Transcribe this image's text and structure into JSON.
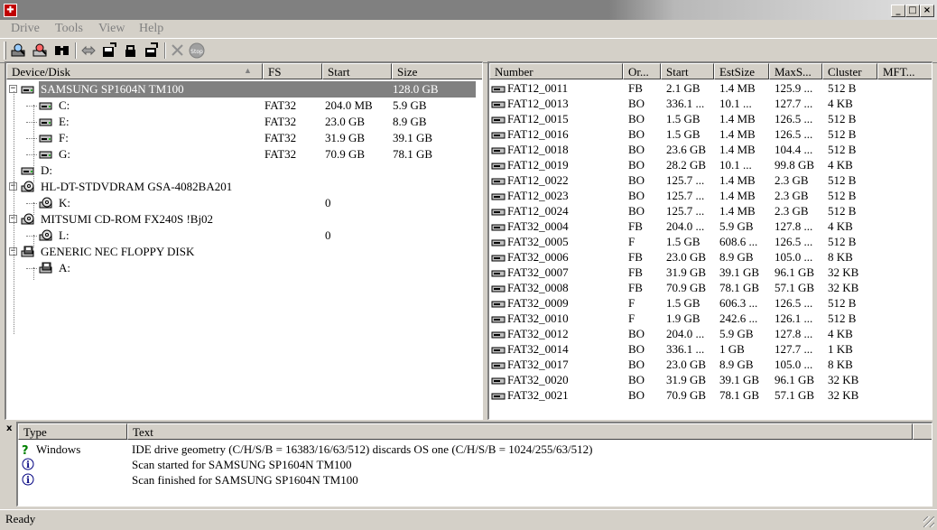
{
  "menu": [
    {
      "label": "Drive"
    },
    {
      "label": "Tools"
    },
    {
      "label": "View"
    },
    {
      "label": "Help"
    }
  ],
  "window_controls": {
    "minimize": "_",
    "maximize": "□",
    "close": "×"
  },
  "toolbar": {
    "buttons": [
      {
        "icon": "scan-drive-icon"
      },
      {
        "icon": "scan-partition-icon"
      },
      {
        "icon": "find-icon"
      },
      {
        "icon": "swap-icon"
      },
      {
        "icon": "save-icon"
      },
      {
        "icon": "lock-icon"
      },
      {
        "icon": "export-icon"
      },
      {
        "icon": "cancel-icon"
      },
      {
        "icon": "stop-icon",
        "label": "Stop"
      }
    ]
  },
  "device_tree": {
    "columns": [
      "Device/Disk",
      "FS",
      "Start",
      "Size"
    ],
    "rows": [
      {
        "name": "SAMSUNG SP1604N TM100",
        "fs": "",
        "start": "",
        "size": "128.0 GB",
        "level": 0,
        "expander": "-",
        "icon": "hard-disk-icon",
        "selected": true
      },
      {
        "name": "C:",
        "fs": "FAT32",
        "start": "204.0 MB",
        "size": "5.9 GB",
        "level": 1,
        "icon": "partition-icon"
      },
      {
        "name": "E:",
        "fs": "FAT32",
        "start": "23.0 GB",
        "size": "8.9 GB",
        "level": 1,
        "icon": "partition-icon"
      },
      {
        "name": "F:",
        "fs": "FAT32",
        "start": "31.9 GB",
        "size": "39.1 GB",
        "level": 1,
        "icon": "partition-icon"
      },
      {
        "name": "G:",
        "fs": "FAT32",
        "start": "70.9 GB",
        "size": "78.1 GB",
        "level": 1,
        "icon": "partition-icon"
      },
      {
        "name": "D:",
        "fs": "",
        "start": "",
        "size": "",
        "level": 0,
        "icon": "partition-icon"
      },
      {
        "name": "HL-DT-STDVDRAM GSA-4082BA201",
        "fs": "",
        "start": "",
        "size": "",
        "level": 0,
        "expander": "-",
        "icon": "cd-drive-icon"
      },
      {
        "name": "K:",
        "fs": "",
        "start": "0",
        "size": "",
        "level": 1,
        "icon": "cd-icon"
      },
      {
        "name": "MITSUMI CD-ROM FX240S !Bj02",
        "fs": "",
        "start": "",
        "size": "",
        "level": 0,
        "expander": "-",
        "icon": "cd-drive-icon"
      },
      {
        "name": "L:",
        "fs": "",
        "start": "0",
        "size": "",
        "level": 1,
        "icon": "cd-icon"
      },
      {
        "name": "GENERIC NEC FLOPPY DISK",
        "fs": "",
        "start": "",
        "size": "",
        "level": 0,
        "expander": "-",
        "icon": "floppy-drive-icon"
      },
      {
        "name": "A:",
        "fs": "",
        "start": "",
        "size": "",
        "level": 1,
        "icon": "floppy-icon"
      }
    ]
  },
  "partition_list": {
    "columns": [
      "Number",
      "Or...",
      "Start",
      "EstSize",
      "MaxS...",
      "Cluster",
      "MFT..."
    ],
    "rows": [
      [
        "FAT12_0011",
        "FB",
        "2.1 GB",
        "1.4 MB",
        "125.9 ...",
        "512 B",
        ""
      ],
      [
        "FAT12_0013",
        "BO",
        "336.1 ...",
        "10.1 ...",
        "127.7 ...",
        "4 KB",
        ""
      ],
      [
        "FAT12_0015",
        "BO",
        "1.5 GB",
        "1.4 MB",
        "126.5 ...",
        "512 B",
        ""
      ],
      [
        "FAT12_0016",
        "BO",
        "1.5 GB",
        "1.4 MB",
        "126.5 ...",
        "512 B",
        ""
      ],
      [
        "FAT12_0018",
        "BO",
        "23.6 GB",
        "1.4 MB",
        "104.4 ...",
        "512 B",
        ""
      ],
      [
        "FAT12_0019",
        "BO",
        "28.2 GB",
        "10.1 ...",
        "99.8 GB",
        "4 KB",
        ""
      ],
      [
        "FAT12_0022",
        "BO",
        "125.7 ...",
        "1.4 MB",
        "2.3 GB",
        "512 B",
        ""
      ],
      [
        "FAT12_0023",
        "BO",
        "125.7 ...",
        "1.4 MB",
        "2.3 GB",
        "512 B",
        ""
      ],
      [
        "FAT12_0024",
        "BO",
        "125.7 ...",
        "1.4 MB",
        "2.3 GB",
        "512 B",
        ""
      ],
      [
        "FAT32_0004",
        "FB",
        "204.0 ...",
        "5.9 GB",
        "127.8 ...",
        "4 KB",
        ""
      ],
      [
        "FAT32_0005",
        "F",
        "1.5 GB",
        "608.6 ...",
        "126.5 ...",
        "512 B",
        ""
      ],
      [
        "FAT32_0006",
        "FB",
        "23.0 GB",
        "8.9 GB",
        "105.0 ...",
        "8 KB",
        ""
      ],
      [
        "FAT32_0007",
        "FB",
        "31.9 GB",
        "39.1 GB",
        "96.1 GB",
        "32 KB",
        ""
      ],
      [
        "FAT32_0008",
        "FB",
        "70.9 GB",
        "78.1 GB",
        "57.1 GB",
        "32 KB",
        ""
      ],
      [
        "FAT32_0009",
        "F",
        "1.5 GB",
        "606.3 ...",
        "126.5 ...",
        "512 B",
        ""
      ],
      [
        "FAT32_0010",
        "F",
        "1.9 GB",
        "242.6 ...",
        "126.1 ...",
        "512 B",
        ""
      ],
      [
        "FAT32_0012",
        "BO",
        "204.0 ...",
        "5.9 GB",
        "127.8 ...",
        "4 KB",
        ""
      ],
      [
        "FAT32_0014",
        "BO",
        "336.1 ...",
        "1 GB",
        "127.7 ...",
        "1 KB",
        ""
      ],
      [
        "FAT32_0017",
        "BO",
        "23.0 GB",
        "8.9 GB",
        "105.0 ...",
        "8 KB",
        ""
      ],
      [
        "FAT32_0020",
        "BO",
        "31.9 GB",
        "39.1 GB",
        "96.1 GB",
        "32 KB",
        ""
      ],
      [
        "FAT32_0021",
        "BO",
        "70.9 GB",
        "78.1 GB",
        "57.1 GB",
        "32 KB",
        ""
      ]
    ]
  },
  "log": {
    "close_label": "x",
    "columns": [
      "Type",
      "Text"
    ],
    "rows": [
      {
        "type": "Windows",
        "icon": "question-icon",
        "text": "IDE drive geometry (C/H/S/B = 16383/16/63/512) discards OS one (C/H/S/B = 1024/255/63/512)"
      },
      {
        "type": "",
        "icon": "info-icon",
        "text": "Scan started for SAMSUNG SP1604N TM100"
      },
      {
        "type": "",
        "icon": "info-icon",
        "text": "Scan finished for SAMSUNG SP1604N TM100"
      }
    ]
  },
  "status": {
    "text": "Ready"
  },
  "colors": {
    "selection": "#808080",
    "face": "#d4d0c8",
    "app_icon": "#c00000"
  }
}
